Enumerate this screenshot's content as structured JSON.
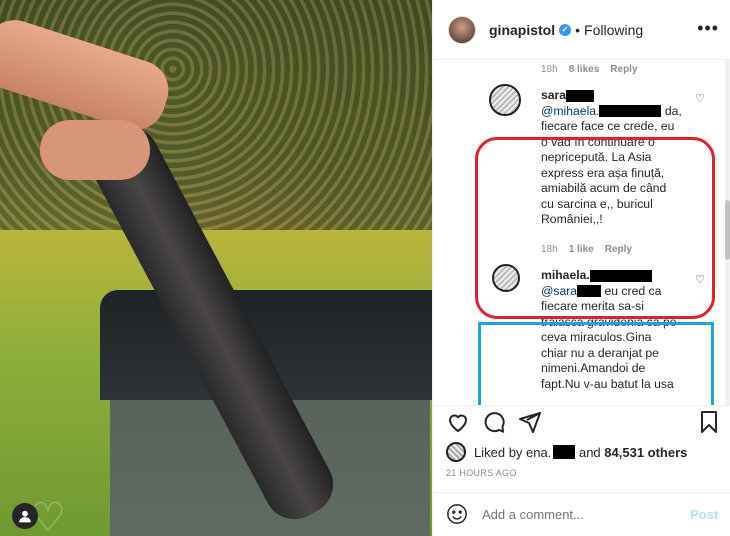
{
  "header": {
    "username": "ginapistol",
    "separator": "•",
    "follow_status": "Following",
    "more_label": "•••"
  },
  "comments": {
    "prev_meta": {
      "time": "18h",
      "likes": "8 likes",
      "reply": "Reply"
    },
    "reply1": {
      "user": "sara",
      "mention": "@mihaela.",
      "text_line1": " da,",
      "lines": [
        "fiecare face ce crede, eu",
        "o văd în continuare o",
        "nepricepută. La Asia",
        "express era așa finuță,",
        "amiabilă acum de când",
        "cu sarcina e,, buricul",
        "României,,!"
      ],
      "meta": {
        "time": "18h",
        "likes": "1 like",
        "reply": "Reply"
      }
    },
    "reply2": {
      "user": "mihaela.",
      "mention": "@sara",
      "text_line1": " eu cred ca",
      "lines": [
        "fiecare merita sa-si",
        "traiasca gravidenia ca pe",
        "ceva miraculos.Gina",
        "chiar nu a deranjat pe",
        "nimeni.Amandoi de",
        "fapt.Nu v-au batut la usa"
      ]
    }
  },
  "actions": {
    "liked_prefix": "Liked by ",
    "liked_user": "ena.",
    "liked_and": " and ",
    "liked_count": "84,531 others",
    "time_ago": "21 HOURS AGO"
  },
  "comment_box": {
    "placeholder": "Add a comment...",
    "post_label": "Post"
  },
  "colors": {
    "red_highlight": "#e0202a",
    "blue_highlight": "#1ea2e0",
    "link": "#00376b",
    "post_disabled": "#b2dffc"
  },
  "icons": [
    "user-tag-icon",
    "verified-icon",
    "heart-icon",
    "comment-icon",
    "share-icon",
    "bookmark-icon",
    "emoji-icon",
    "like-small-icon"
  ]
}
